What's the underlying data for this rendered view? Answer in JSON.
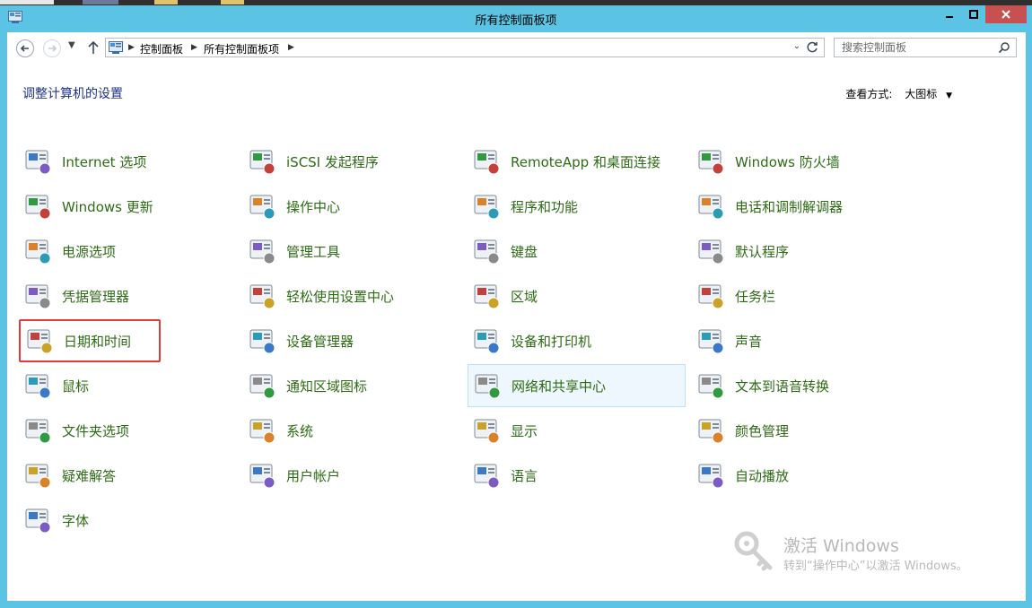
{
  "window": {
    "title": "所有控制面板项",
    "controls": {
      "minimize": "minimize-icon",
      "maximize": "maximize-icon",
      "close": "close-icon"
    }
  },
  "address_bar": {
    "breadcrumbs": [
      "控制面板",
      "所有控制面板项"
    ],
    "search_placeholder": "搜索控制面板"
  },
  "content": {
    "heading": "调整计算机的设置",
    "view_by_label": "查看方式:",
    "view_by_value": "大图标"
  },
  "columns": [
    [
      {
        "label": "Internet 选项",
        "icon": "internet-options-icon"
      },
      {
        "label": "Windows 更新",
        "icon": "windows-update-icon"
      },
      {
        "label": "电源选项",
        "icon": "power-options-icon"
      },
      {
        "label": "凭据管理器",
        "icon": "credential-manager-icon"
      },
      {
        "label": "日期和时间",
        "icon": "date-time-icon",
        "state": "selected"
      },
      {
        "label": "鼠标",
        "icon": "mouse-icon"
      },
      {
        "label": "文件夹选项",
        "icon": "folder-options-icon"
      },
      {
        "label": "疑难解答",
        "icon": "troubleshooting-icon"
      },
      {
        "label": "字体",
        "icon": "fonts-icon"
      }
    ],
    [
      {
        "label": "iSCSI 发起程序",
        "icon": "iscsi-initiator-icon"
      },
      {
        "label": "操作中心",
        "icon": "action-center-icon"
      },
      {
        "label": "管理工具",
        "icon": "administrative-tools-icon"
      },
      {
        "label": "轻松使用设置中心",
        "icon": "ease-of-access-icon"
      },
      {
        "label": "设备管理器",
        "icon": "device-manager-icon"
      },
      {
        "label": "通知区域图标",
        "icon": "notification-area-icon"
      },
      {
        "label": "系统",
        "icon": "system-icon"
      },
      {
        "label": "用户帐户",
        "icon": "user-accounts-icon"
      }
    ],
    [
      {
        "label": "RemoteApp 和桌面连接",
        "icon": "remoteapp-icon"
      },
      {
        "label": "程序和功能",
        "icon": "programs-features-icon"
      },
      {
        "label": "键盘",
        "icon": "keyboard-icon"
      },
      {
        "label": "区域",
        "icon": "region-icon"
      },
      {
        "label": "设备和打印机",
        "icon": "devices-printers-icon"
      },
      {
        "label": "网络和共享中心",
        "icon": "network-sharing-icon",
        "state": "hover"
      },
      {
        "label": "显示",
        "icon": "display-icon"
      },
      {
        "label": "语言",
        "icon": "language-icon"
      }
    ],
    [
      {
        "label": "Windows 防火墙",
        "icon": "firewall-icon"
      },
      {
        "label": "电话和调制解调器",
        "icon": "phone-modem-icon"
      },
      {
        "label": "默认程序",
        "icon": "default-programs-icon"
      },
      {
        "label": "任务栏",
        "icon": "taskbar-icon"
      },
      {
        "label": "声音",
        "icon": "sound-icon"
      },
      {
        "label": "文本到语音转换",
        "icon": "text-to-speech-icon"
      },
      {
        "label": "颜色管理",
        "icon": "color-management-icon"
      },
      {
        "label": "自动播放",
        "icon": "autoplay-icon"
      }
    ]
  ],
  "watermark": {
    "title": "激活 Windows",
    "subtitle": "转到“操作中心”以激活 Windows。"
  }
}
